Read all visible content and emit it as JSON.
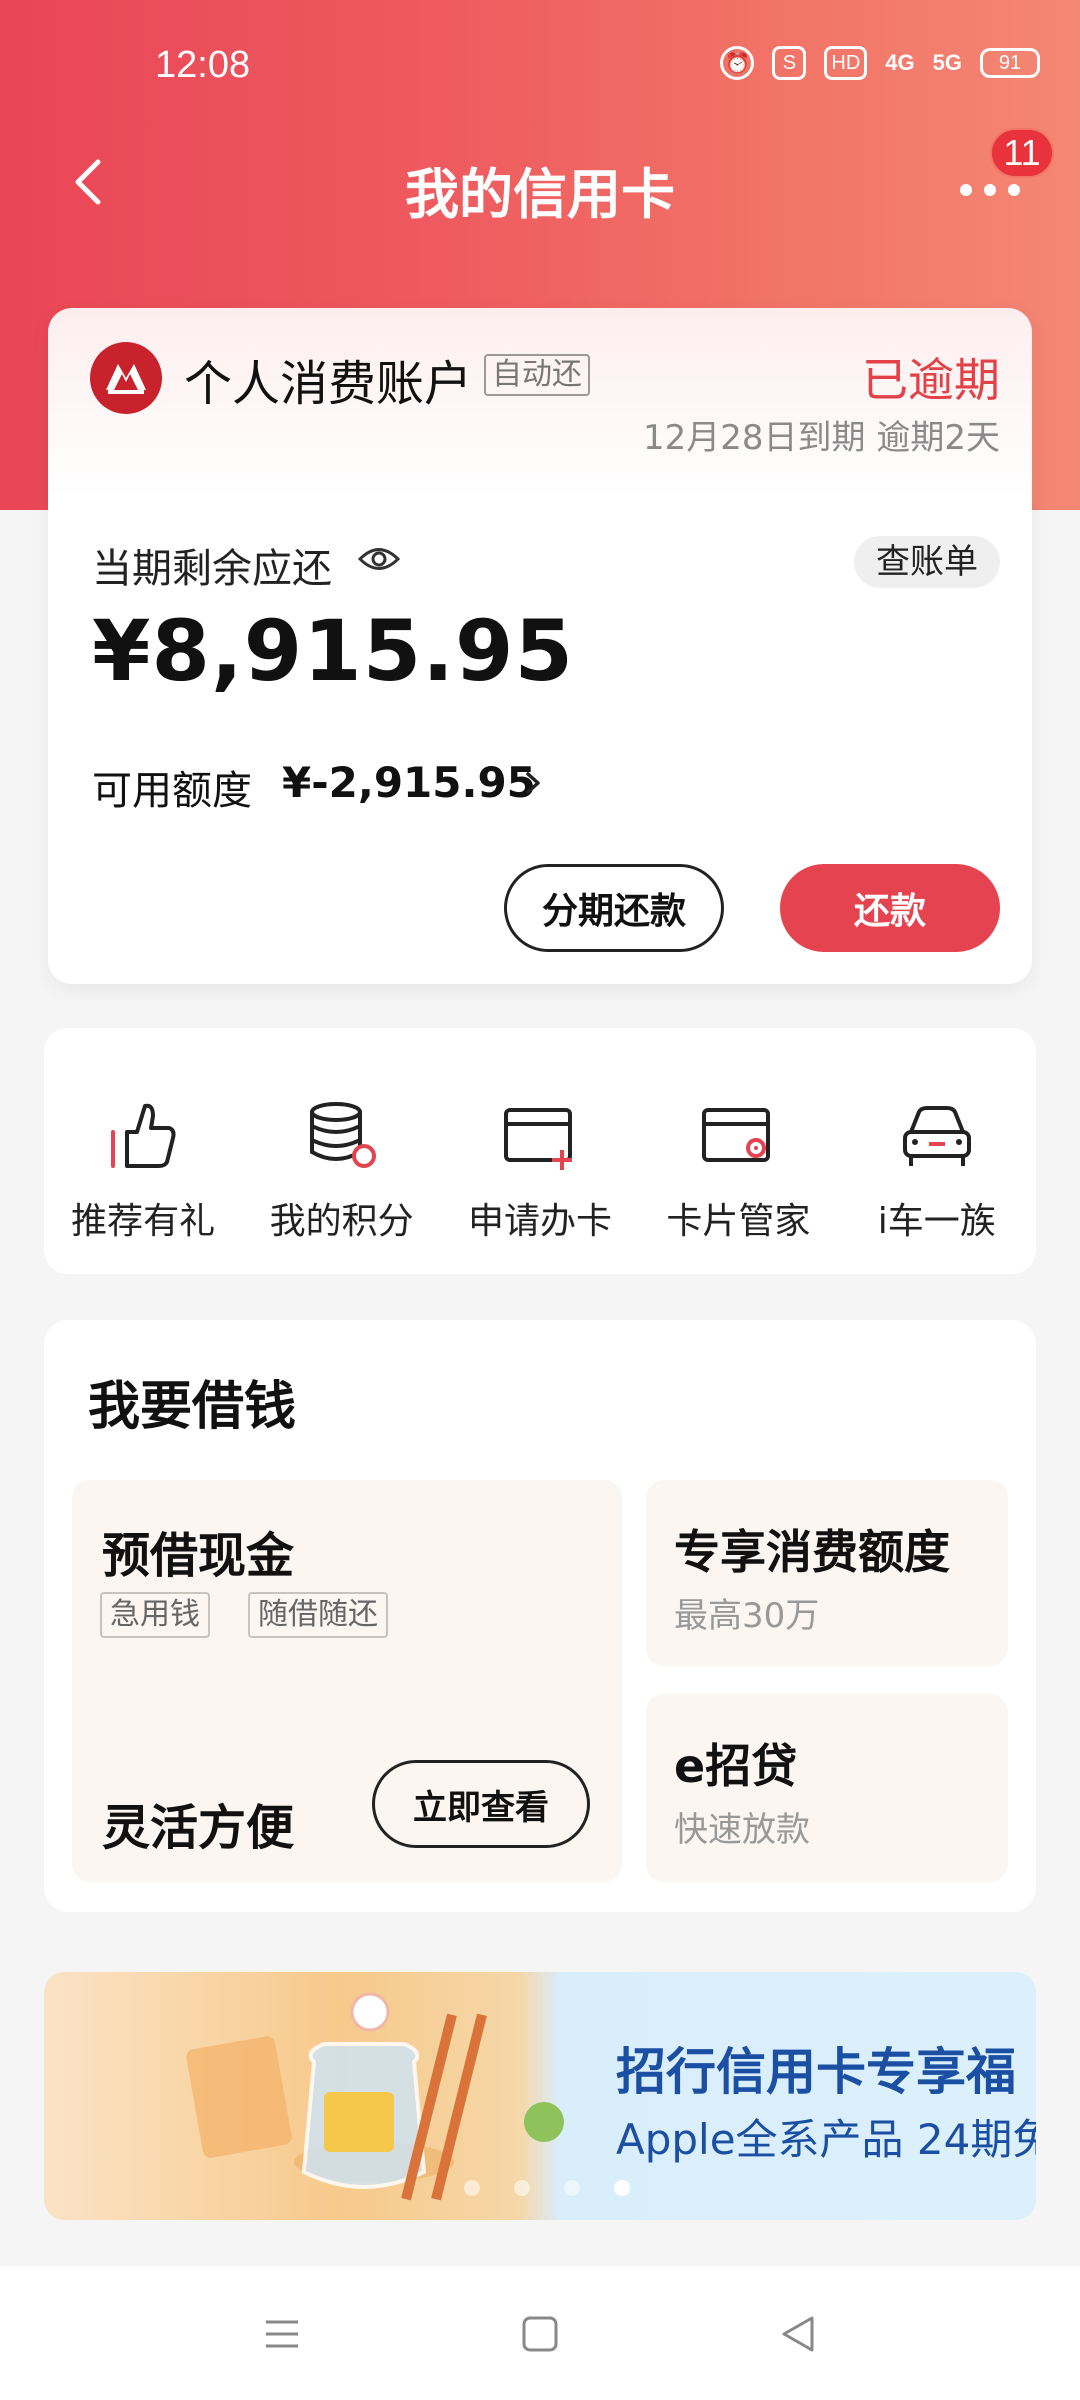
{
  "status_bar": {
    "time": "12:08",
    "network1": "4G",
    "network2": "5G",
    "hd": "HD",
    "battery": "91"
  },
  "nav": {
    "title": "我的信用卡",
    "badge_count": "11"
  },
  "account": {
    "name": "个人消费账户",
    "auto_tag": "自动还",
    "status": "已逾期",
    "due_line": "12月28日到期 逾期2天",
    "remaining_label": "当期剩余应还",
    "bill_button": "查账单",
    "amount": "¥8,915.95",
    "credit_label": "可用额度",
    "credit_value": "¥-2,915.95",
    "installment_button": "分期还款",
    "pay_button": "还款"
  },
  "quick_actions": [
    {
      "label": "推荐有礼",
      "icon": "thumbs-up-icon"
    },
    {
      "label": "我的积分",
      "icon": "coins-stack-icon"
    },
    {
      "label": "申请办卡",
      "icon": "card-add-icon"
    },
    {
      "label": "卡片管家",
      "icon": "card-settings-icon"
    },
    {
      "label": "i车一族",
      "icon": "car-icon"
    }
  ],
  "borrow": {
    "title": "我要借钱",
    "cash": {
      "title": "预借现金",
      "tags": [
        "急用钱",
        "随借随还"
      ],
      "footer": "灵活方便",
      "button": "立即查看"
    },
    "exclusive": {
      "title": "专享消费额度",
      "sub": "最高30万"
    },
    "eloan": {
      "title": "e招贷",
      "sub": "快速放款"
    }
  },
  "banner": {
    "title": "招行信用卡专享福",
    "sub": "Apple全系产品 24期免",
    "slide_index": 4,
    "slide_count": 4
  },
  "colors": {
    "brand_red": "#e4434f",
    "overdue_red": "#e34148",
    "banner_blue": "#1a4fa3"
  }
}
